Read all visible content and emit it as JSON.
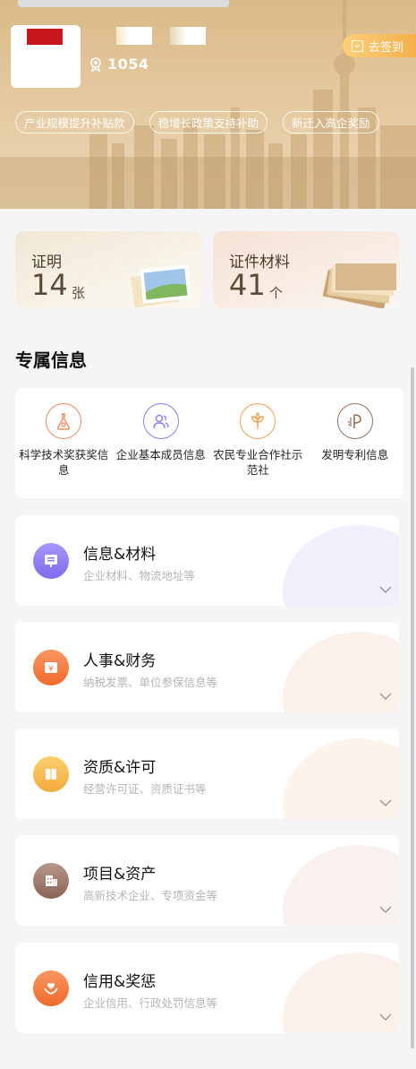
{
  "profile": {
    "points": "1054",
    "signin_label": "去签到"
  },
  "tags": [
    "产业规模提升补贴款",
    "稳增长政策支持补助",
    "新迁入高企奖励"
  ],
  "stats": [
    {
      "label": "证明",
      "value": "14",
      "unit": "张"
    },
    {
      "label": "证件材料",
      "value": "41",
      "unit": "个"
    }
  ],
  "section": {
    "title": "专属信息",
    "grid": [
      {
        "label": "科学技术奖获奖信息",
        "icon": "flask-icon",
        "color": "#f08a5d"
      },
      {
        "label": "企业基本成员信息",
        "icon": "people-icon",
        "color": "#8c7ef0"
      },
      {
        "label": "农民专业合作社示范社",
        "icon": "sprout-icon",
        "color": "#f0a050"
      },
      {
        "label": "发明专利信息",
        "icon": "patent-icon",
        "color": "#9a6e5a"
      }
    ],
    "list": [
      {
        "title": "信息&材料",
        "subtitle": "企业材料、物流地址等",
        "icon": "document-icon",
        "color": "#8f7cf2",
        "deco": "#f1effc"
      },
      {
        "title": "人事&财务",
        "subtitle": "纳税发票、单位参保信息等",
        "icon": "finance-icon",
        "color": "#f27b3e",
        "deco": "#fcf1ea"
      },
      {
        "title": "资质&许可",
        "subtitle": "经营许可证、资质证书等",
        "icon": "book-icon",
        "color": "#f5b844",
        "deco": "#fcf4ea"
      },
      {
        "title": "项目&资产",
        "subtitle": "高新技术企业、专项资金等",
        "icon": "building-icon",
        "color": "#9c7968",
        "deco": "#f8f1ed"
      },
      {
        "title": "信用&奖惩",
        "subtitle": "企业信用、行政处罚信息等",
        "icon": "hands-heart-icon",
        "color": "#f27b3e",
        "deco": "#fcf1ea"
      }
    ]
  }
}
